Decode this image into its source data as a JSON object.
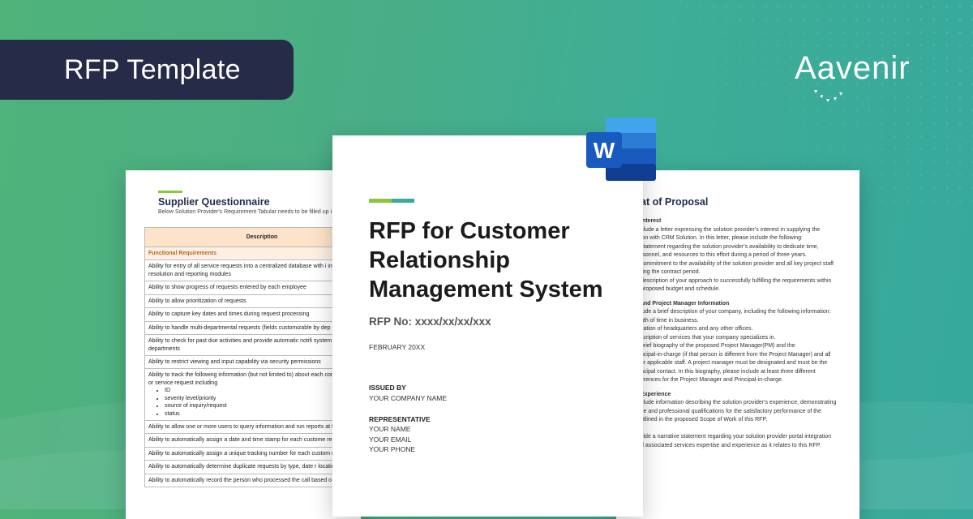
{
  "banner": {
    "title": "RFP Template"
  },
  "brand": {
    "logo_text": "Aavenir"
  },
  "colors": {
    "banner_bg": "#262b47",
    "accent_green": "#8cc63f",
    "accent_teal": "#3aaa9e",
    "word_blue": "#185abd"
  },
  "icons": {
    "word": "microsoft-word-icon"
  },
  "supplier_doc": {
    "title": "Supplier Questionnaire",
    "subtitle": "Below Solution Provider's Requirement Tabular needs to be filled up i",
    "header": "Description",
    "section": "Functional Requirements",
    "rows": [
      "Ability for entry of all service requests into a centralized database with i intake, routing, resolution and reporting modules",
      "Ability to show progress of requests entered by each employee",
      "Ability to allow prioritization of requests",
      "Ability to capture key dates and times during request processing",
      "Ability to handle multi-departmental requests (fields customizable by dep",
      "Ability to check for past due activities and provide automatic notifi system or e-mail to departments",
      "Ability to restrict viewing and input capability via security permissions",
      "Ability to track the following information (but not limited to) about each contact for inquiry or service request including",
      "Ability to allow one or more users to query information and run reports at time",
      "Ability to automatically assign a date and time stamp for each custome request",
      "Ability to automatically assign a unique tracking number for each custom request",
      "Ability to automatically determine duplicate requests by type, date r location",
      "Ability to automatically record the person who processed the call based o"
    ],
    "bullets": [
      "ID",
      "severity level/priority",
      "source of inquiry/request",
      "status"
    ]
  },
  "proposal_doc": {
    "title": "at of Proposal",
    "sections": [
      {
        "heading": "Interest",
        "lines": [
          "clude a letter expressing the solution provider's interest in supplying the",
          "ion with CRM Solution. In this letter, please include the following:",
          "statement regarding the solution provider's availability to dedicate time,",
          "rsonnel, and resources to this effort during a period of three years.",
          "commitment to the availability of the solution provider and all key project staff",
          "ring the contract period.",
          "description of your approach to successfully fulfilling the requirements within",
          "proposed budget and schedule."
        ]
      },
      {
        "heading": "and Project Manager Information",
        "lines": [
          "lude a brief description of your company, including the following information:",
          "gth of time in business.",
          "cation of headquarters and any other offices.",
          "scription of services that your company specializes in.",
          "brief biography of the proposed Project Manager(PM) and the",
          "ncipal-in-charge (if that person is different from the Project Manager) and all",
          "er applicable staff. A project manager must be designated and must be the",
          "ncipal contact. In this biography, please include at least three different",
          "erences for the Project Manager and Principal-in-charge."
        ]
      },
      {
        "heading": "Experience",
        "lines": [
          "clude information describing the solution provider's experience, demonstrating",
          "ce and professional qualifications for the satisfactory performance of the",
          "utlined in the proposed Scope of Work of this RFP.",
          "",
          "vide a narrative statement regarding your solution provider portal integration",
          "d associated services expertise and experience as it relates to this RFP."
        ]
      }
    ]
  },
  "cover_doc": {
    "title": "RFP for Customer Relationship Management System",
    "rfp_no": "RFP No: xxxx/xx/xx/xxx",
    "date": "FEBRUARY 20XX",
    "issued_by_label": "ISSUED BY",
    "company": "YOUR COMPANY NAME",
    "representative_label": "REPRESENTATIVE",
    "rep_name": "YOUR NAME",
    "rep_email": "YOUR EMAIL",
    "rep_phone": "YOUR PHONE"
  }
}
